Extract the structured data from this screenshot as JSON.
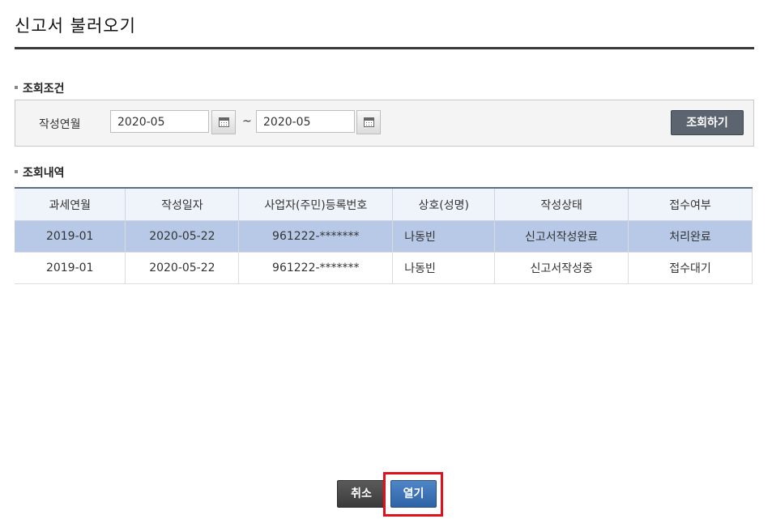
{
  "title": "신고서 불러오기",
  "search": {
    "section_label": "조회조건",
    "date_label": "작성연월",
    "from_value": "2020-05",
    "to_value": "2020-05",
    "separator": "~",
    "search_button": "조회하기"
  },
  "results": {
    "section_label": "조회내역",
    "headers": [
      "과세연월",
      "작성일자",
      "사업자(주민)등록번호",
      "상호(성명)",
      "작성상태",
      "접수여부"
    ],
    "rows": [
      [
        "2019-01",
        "2020-05-22",
        "961222-*******",
        "나동빈",
        "신고서작성완료",
        "처리완료"
      ],
      [
        "2019-01",
        "2020-05-22",
        "961222-*******",
        "나동빈",
        "신고서작성중",
        "접수대기"
      ]
    ],
    "selected_row": 0
  },
  "footer": {
    "cancel_button": "취소",
    "open_button": "열기"
  },
  "colors": {
    "selected_row": "#b7c9e7",
    "open_button": "#3a6fb3",
    "highlight": "#e0111a"
  },
  "icons": [
    "calendar-icon"
  ]
}
